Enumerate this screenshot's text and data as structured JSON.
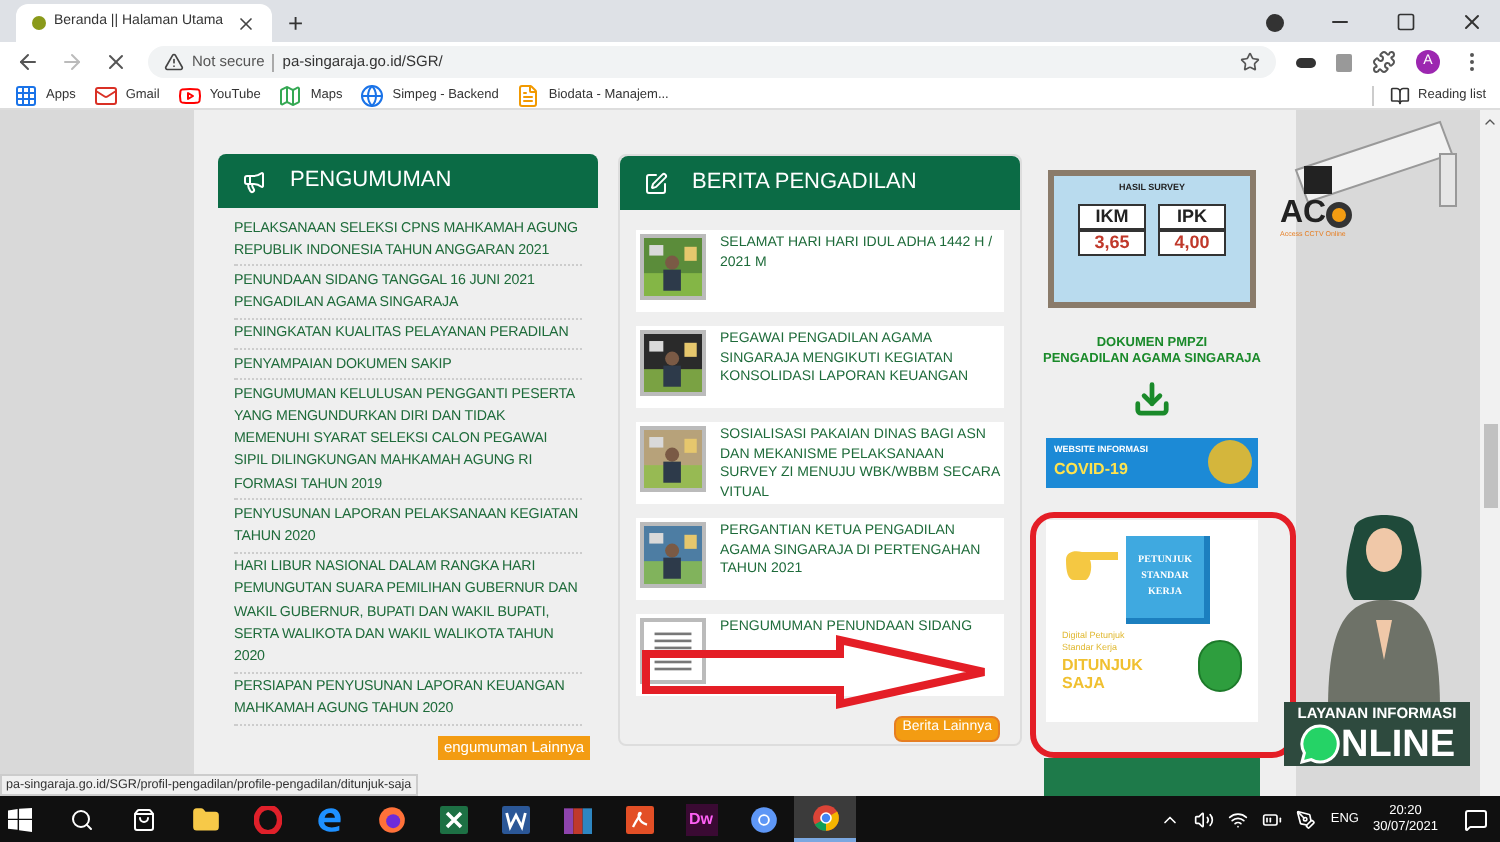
{
  "browser": {
    "tab": {
      "title": "Beranda || Halaman Utama"
    },
    "new_tab": "+",
    "address": {
      "security": "Not secure",
      "url": "pa-singaraja.go.id/SGR/"
    },
    "bookmarks": [
      {
        "label": "Apps",
        "kind": "apps"
      },
      {
        "label": "Gmail",
        "kind": "gmail"
      },
      {
        "label": "YouTube",
        "kind": "youtube"
      },
      {
        "label": "Maps",
        "kind": "maps"
      },
      {
        "label": "Simpeg - Backend",
        "kind": "globe"
      },
      {
        "label": "Biodata - Manajem...",
        "kind": "doc"
      }
    ],
    "reading_list": "Reading list",
    "profile": "A"
  },
  "pengumuman": {
    "title": "PENGUMUMAN",
    "items": [
      "PELAKSANAAN SELEKSI CPNS MAHKAMAH AGUNG REPUBLIK INDONESIA TAHUN ANGGARAN 2021",
      "PENUNDAAN SIDANG TANGGAL 16 JUNI 2021 PENGADILAN AGAMA SINGARAJA",
      "PENINGKATAN KUALITAS PELAYANAN PERADILAN",
      "PENYAMPAIAN DOKUMEN SAKIP",
      "PENGUMUMAN KELULUSAN PENGGANTI PESERTA YANG MENGUNDURKAN DIRI DAN TIDAK MEMENUHI SYARAT SELEKSI CALON PEGAWAI SIPIL DILINGKUNGAN MAHKAMAH AGUNG RI FORMASI TAHUN 2019",
      "PENYUSUNAN LAPORAN PELAKSANAAN KEGIATAN TAHUN 2020",
      "HARI LIBUR NASIONAL DALAM RANGKA HARI PEMUNGUTAN SUARA PEMILIHAN GUBERNUR DAN WAKIL GUBERNUR, BUPATI DAN WAKIL BUPATI, SERTA WALIKOTA DAN WAKIL WALIKOTA TAHUN 2020",
      "PERSIAPAN PENYUSUNAN LAPORAN KEUANGAN MAHKAMAH AGUNG TAHUN 2020"
    ],
    "more_button": "engumuman Lainnya"
  },
  "berita": {
    "title": "BERITA PENGADILAN",
    "items": [
      {
        "title": "SELAMAT HARI HARI IDUL ADHA 1442 H / 2021 M",
        "kind": "picture"
      },
      {
        "title": "PEGAWAI PENGADILAN AGAMA SINGARAJA MENGIKUTI KEGIATAN KONSOLIDASI LAPORAN KEUANGAN",
        "kind": "picture"
      },
      {
        "title": "SOSIALISASI PAKAIAN DINAS BAGI ASN DAN MEKANISME PELAKSANAAN SURVEY ZI MENUJU WBK/WBBM SECARA VITUAL",
        "kind": "picture"
      },
      {
        "title": "PERGANTIAN KETUA PENGADILAN AGAMA SINGARAJA DI PERTENGAHAN TAHUN 2021",
        "kind": "picture"
      },
      {
        "title": "PENGUMUMAN PENUNDAAN SIDANG",
        "kind": "document"
      }
    ],
    "more_button": "Berita Lainnya"
  },
  "sidebar": {
    "survey": {
      "heading": "HASIL SURVEY",
      "ikm_label": "IKM",
      "ikm_value": "3,65",
      "ipk_label": "IPK",
      "ipk_value": "4,00"
    },
    "pmpzi": {
      "line1": "DOKUMEN PMPZI",
      "line2": "PENGADILAN AGAMA SINGARAJA"
    },
    "covid": {
      "line1": "WEBSITE INFORMASI",
      "line2": "COVID-19"
    },
    "petunjuk": {
      "book": "PETUNJUK STANDAR KERJA",
      "subtitle": "Digital Petunjuk Standar Kerja",
      "title": "DITUNJUK SAJA"
    }
  },
  "overlays": {
    "cctv": {
      "logo": "AC",
      "tagline": "Access CCTV Online"
    },
    "layanan": {
      "line1": "LAYANAN INFORMASI",
      "line2": "NLINE"
    }
  },
  "status_url": "pa-singaraja.go.id/SGR/profil-pengadilan/profile-pengadilan/ditunjuk-saja",
  "taskbar": {
    "apps": [
      {
        "kind": "start",
        "selected": false
      },
      {
        "kind": "search",
        "selected": false
      },
      {
        "kind": "store",
        "selected": false
      },
      {
        "kind": "folder",
        "selected": false
      },
      {
        "kind": "opera",
        "selected": false
      },
      {
        "kind": "edge",
        "selected": false
      },
      {
        "kind": "firefox",
        "selected": false
      },
      {
        "kind": "excel",
        "selected": false
      },
      {
        "kind": "word",
        "selected": false
      },
      {
        "kind": "archive",
        "selected": false
      },
      {
        "kind": "acrobat",
        "selected": false
      },
      {
        "kind": "dw",
        "label": "Dw",
        "selected": false
      },
      {
        "kind": "chromium",
        "selected": false
      },
      {
        "kind": "chrome",
        "selected": true
      }
    ],
    "language": "ENG",
    "time": "20:20",
    "date": "30/07/2021"
  }
}
